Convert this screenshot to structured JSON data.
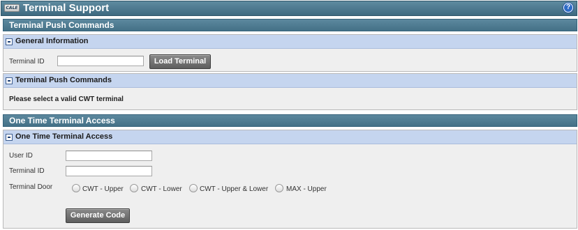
{
  "app": {
    "logo_text": "CALE",
    "title": "Terminal Support"
  },
  "push_section": {
    "title": "Terminal Push Commands",
    "general_panel": {
      "title": "General Information",
      "terminal_id_label": "Terminal ID",
      "terminal_id_value": "",
      "load_button": "Load Terminal"
    },
    "commands_panel": {
      "title": "Terminal Push Commands",
      "message": "Please select a valid CWT terminal"
    }
  },
  "access_section": {
    "title": "One Time Terminal Access",
    "panel": {
      "title": "One Time Terminal Access",
      "user_id_label": "User ID",
      "user_id_value": "",
      "terminal_id_label": "Terminal ID",
      "terminal_id_value": "",
      "terminal_door_label": "Terminal Door",
      "door_options": [
        "CWT - Upper",
        "CWT - Lower",
        "CWT - Upper & Lower",
        "MAX - Upper"
      ],
      "generate_button": "Generate Code"
    }
  },
  "colors": {
    "section_bar": "#447187",
    "panel_header": "#c5d5ef",
    "panel_body": "#efefef",
    "button": "#6a6a6a"
  }
}
